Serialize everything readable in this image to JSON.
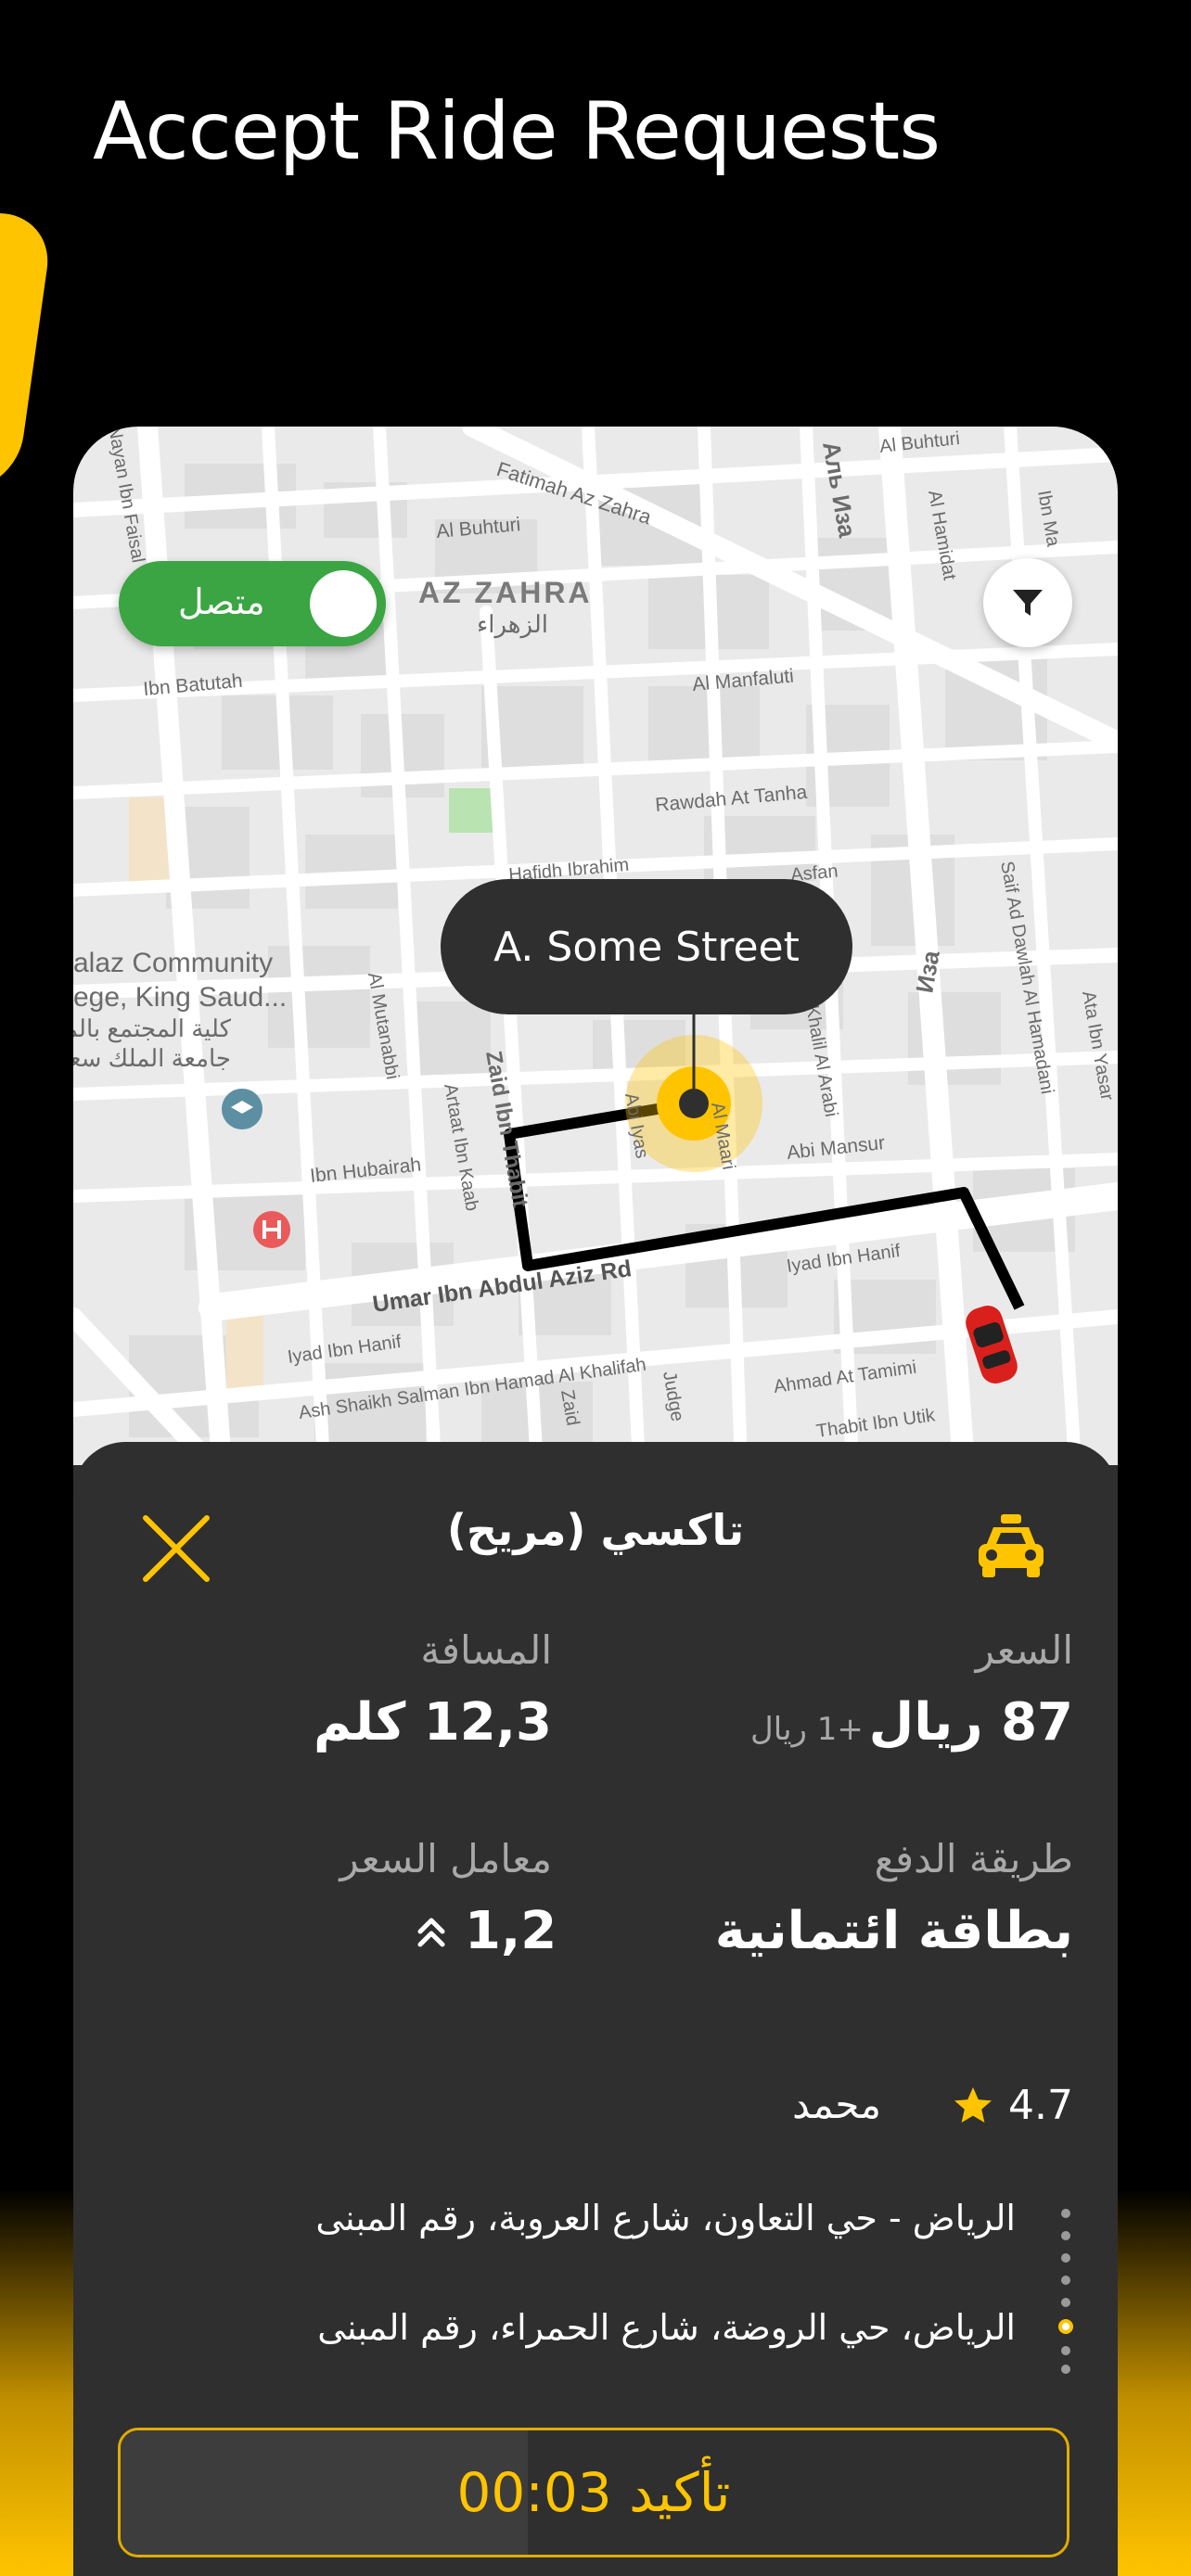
{
  "promo": {
    "title": "Accept Ride Requests"
  },
  "map": {
    "status_toggle_label": "متصل",
    "street_bubble": "A.  Some Street",
    "labels": {
      "az_zahra": "AZ ZAHRA",
      "az_zahra_ar": "الزهراء",
      "fatimah": "Fatimah Az Zahra",
      "al_buhturi_1": "Al Buhturi",
      "al_buhturi_2": "Al Buhturi",
      "ibn_batutah": "Ibn Batutah",
      "al_manfaluti": "Al Manfaluti",
      "rawdah": "Rawdah At Tanha",
      "ibrahim": "Hafidh Ibrahim",
      "asfan": "Asfan",
      "college_1": "alaz Community",
      "college_2": "ege, King Saud...",
      "college_3": "كلية المجتمع بالملز",
      "college_4": "جامعة الملك سعود",
      "al_mutanabbi": "Al Mutanabbi",
      "artaat": "Artaat Ibn Kaab",
      "zaid": "Zaid Ibn Thabit",
      "abu_mansur": "Abi Mansur",
      "al_maari": "Al Maari",
      "ibn_hubairah": "Ibn Hubairah",
      "umar": "Umar Ibn Abdul Aziz Rd",
      "iyad_1": "Iyad Ibn Hanif",
      "iyad_2": "Iyad Ibn Hanif",
      "ash_shaikh": "Ash Shaikh Salman Ibn Hamad Al Khalifah",
      "ahmad": "Ahmad At Tamimi",
      "thabit": "Thabit Ibn Utik",
      "saif": "Saif Ad Dawlah Al Hamadani",
      "ata": "Ata Ibn Yasar",
      "al_hamidat": "Al Hamidat",
      "al_buhturi_3": "Al Buhturi",
      "alb_iza": "Аль Иза",
      "iza": "Иза",
      "ibn_faisal": "Nayan Ibn Faisal",
      "ibn_ma": "Ibn Ma",
      "judge": "Judge",
      "abi_iyas": "Abi Iyas",
      "khalil": "Khalil Al Arabi",
      "zaid2": "Zaid"
    }
  },
  "request": {
    "service_name": "تاكسي (مريح)",
    "fare_label": "السعر",
    "fare_value": "87 ريال",
    "fare_extra": "+1 ريال",
    "distance_label": "المسافة",
    "distance_value": "12,3 كلم",
    "payment_label": "طريقة الدفع",
    "payment_value": "بطاقة ائتمانية",
    "multiplier_label": "معامل السعر",
    "multiplier_value": "1,2",
    "rating": "4.7",
    "rider_name": "محمد",
    "pickup_address": "الرياض - حي التعاون، شارع العروبة، رقم المبنى",
    "dropoff_address": "الرياض، حي الروضة، شارع الحمراء، رقم المبنى",
    "confirm_label": "تأكيد 00:03",
    "confirm_progress": 0.43
  },
  "colors": {
    "accent": "#ffc400",
    "online_green": "#3aa542",
    "sheet_bg": "#2f2f2f",
    "route": "#000000",
    "car_red": "#d9201c"
  },
  "icons": [
    "close-icon",
    "taxi-icon",
    "filter-icon",
    "star-icon",
    "chevron-up-icon",
    "car-icon",
    "hospital-icon",
    "school-icon"
  ]
}
